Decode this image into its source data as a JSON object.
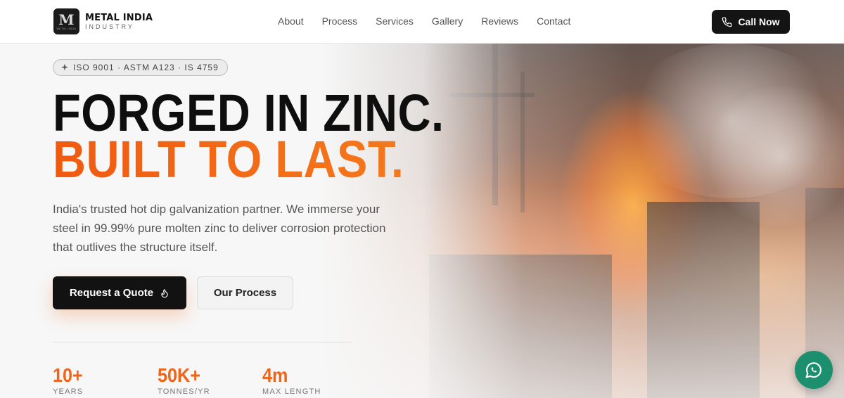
{
  "brand": {
    "logo_letter": "M",
    "logo_sub": "METAL INDIA",
    "title": "METAL INDIA",
    "subtitle": "INDUSTRY"
  },
  "nav": {
    "items": [
      {
        "label": "About"
      },
      {
        "label": "Process"
      },
      {
        "label": "Services"
      },
      {
        "label": "Gallery"
      },
      {
        "label": "Reviews"
      },
      {
        "label": "Contact"
      }
    ],
    "call_label": "Call Now"
  },
  "hero": {
    "badge": "ISO 9001 · ASTM A123 · IS 4759",
    "headline_line1": "FORGED IN ZINC.",
    "headline_line2": "BUILT TO LAST.",
    "description": "India's trusted hot dip galvanization partner. We immerse your steel in 99.99% pure molten zinc to deliver corrosion protection that outlives the structure itself.",
    "primary_cta": "Request a Quote",
    "secondary_cta": "Our Process"
  },
  "stats": [
    {
      "value": "10+",
      "label": "YEARS"
    },
    {
      "value": "50K+",
      "label": "TONNES/YR"
    },
    {
      "value": "4m",
      "label": "MAX LENGTH"
    }
  ],
  "colors": {
    "accent": "#ef6419",
    "dark": "#121212",
    "whatsapp": "#1c8f6f"
  },
  "icons": {
    "phone": "phone-icon",
    "flame": "flame-icon",
    "badge": "sparkle-icon",
    "whatsapp": "whatsapp-icon"
  }
}
